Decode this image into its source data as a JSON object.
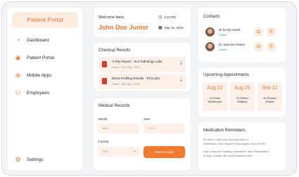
{
  "brand": "Patient Portal",
  "nav": [
    {
      "label": "Dashboard",
      "icon": "dashboard-icon"
    },
    {
      "label": "Patient Portal",
      "icon": "user-icon"
    },
    {
      "label": "Mobile Apps",
      "icon": "globe-icon"
    },
    {
      "label": "Employees",
      "icon": "users-icon"
    }
  ],
  "settings_label": "Settings",
  "welcome": {
    "greeting": "Welcome back,",
    "name": "John Doe Junior",
    "time": "2:22 PM",
    "date": "Sep 16, 2024"
  },
  "checkup": {
    "title": "Checkup Results",
    "reports": [
      {
        "name": "X-Ray Report - Sun Pathology Labs",
        "date": "Dated : 23rd Sep, 2024"
      },
      {
        "name": "Blood Profiling Results - XTCLabs",
        "date": "Dated : 26th Sep, 2024"
      }
    ]
  },
  "records": {
    "title": "Medical Records",
    "month_label": "Month",
    "month_value": "MM",
    "year_label": "Year",
    "year_value": "YYYY",
    "format_label": "Format",
    "format_value": "PDF",
    "fetch_label": "Fetch records"
  },
  "contacts": {
    "title": "Contacts",
    "items": [
      {
        "name": "Dr Emily Heeth",
        "status": "Online"
      },
      {
        "name": "Dr Jasmine Peters",
        "status": "Online"
      }
    ]
  },
  "appointments": {
    "title": "Upcoming Appointments",
    "items": [
      {
        "date": "Aug 22",
        "doctor_line1": "Dr Emily",
        "doctor_line2": "Westbrooke"
      },
      {
        "date": "Aug 25",
        "doctor_line1": "Dr Robert",
        "doctor_line2": "Williams"
      },
      {
        "date": "Sep 12",
        "doctor_line1": "Dr Richard",
        "doctor_line2": "Evants"
      }
    ]
  },
  "reminders": {
    "title": "Medication Reminders",
    "line1": "It's time to take your morning dose of",
    "line2": "medication. Don't forget to take Aspirin at 12:00 PM.",
    "line3": "Don't miss your midday medication! Take Paracetamol",
    "line4": "to stay on track with your treatment plan."
  },
  "colors": {
    "accent": "#e8772e",
    "online": "#23a559",
    "tint": "#fdf0e8"
  }
}
